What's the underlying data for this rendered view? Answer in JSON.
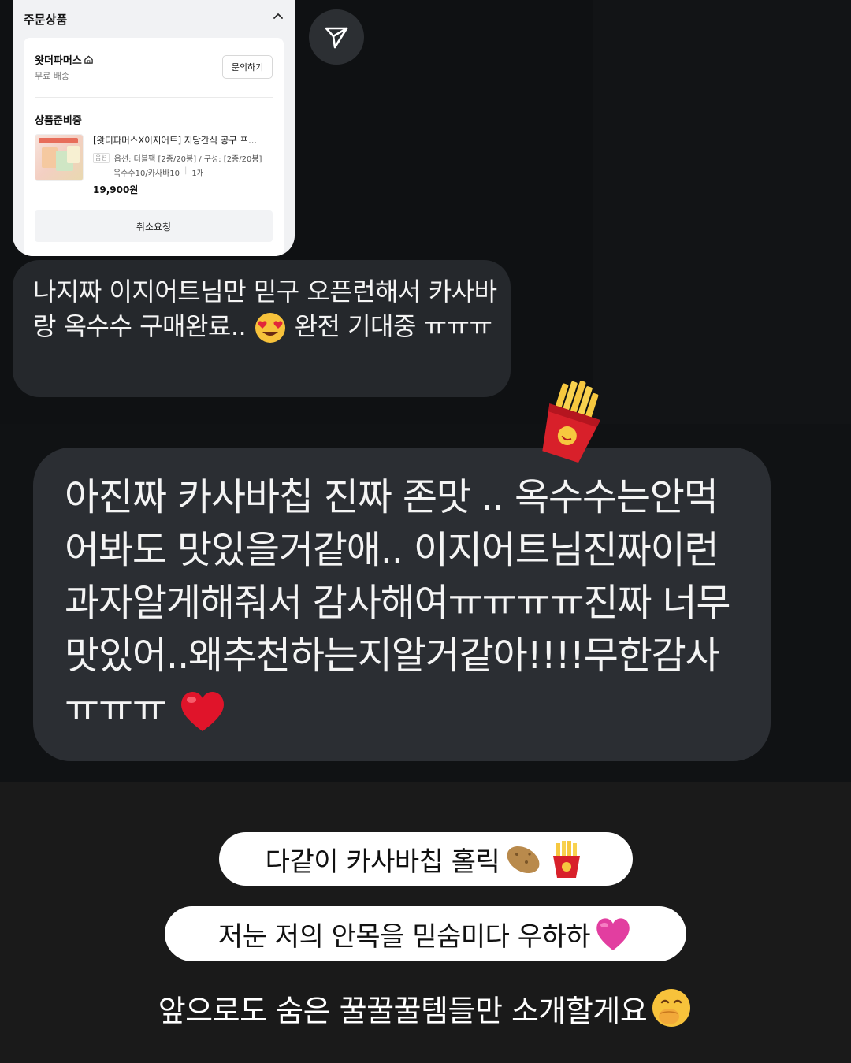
{
  "order_card": {
    "header": "주문상품",
    "seller": "왓더파머스",
    "shipping": "무료 배송",
    "inquiry_button": "문의하기",
    "status": "상품준비중",
    "product_name": "[왓더파머스X이지어트] 저당간식 공구 프...",
    "option_tag": "옵션",
    "option_line1": "옵션: 더블팩 [2종/20봉] / 구성: [2종/20봉]",
    "option_line2_a": "옥수수10/카사바10",
    "option_line2_b": "1개",
    "price": "19,900원",
    "cancel_button": "취소요청"
  },
  "messages": {
    "msg1_part1": "나지짜 이지어트님만 믿구 오픈런해서 카사바랑 옥수수 구매완료..",
    "msg1_part2": "완전 기대중 ㅠㅠㅠ",
    "msg2_part1": "아진짜 카사바칩 진짜 존맛 .. 옥수수는안먹어봐도 맛있을거같애.. 이지어트님진짜이런과자알게해줘서 감사해여ㅠㅠㅠㅠ진짜 너무맛있어..왜추천하는지알거같아!!!!무한감사ㅠㅠㅠ"
  },
  "captions": {
    "caption1": "다같이 카사바칩 홀릭",
    "caption2": "저눈 저의 안목을 믿숨미다 우하하",
    "caption3": "앞으로도 숨은 꿀꿀꿀템들만 소개할게요"
  },
  "icons": {
    "send": "send-icon",
    "chevron": "chevron-up-icon",
    "home": "home-icon",
    "heart_eyes": "heart-eyes-emoji-icon",
    "fries": "fries-icon",
    "heart": "red-heart-icon",
    "potato": "potato-icon",
    "pink_heart": "pink-heart-icon",
    "hand_over_mouth": "hand-over-mouth-emoji-icon"
  },
  "colors": {
    "bubble_dark": "#25282c",
    "caption_pill": "#ffffff",
    "heart_red": "#e0142a",
    "heart_pink": "#e23ea0"
  }
}
